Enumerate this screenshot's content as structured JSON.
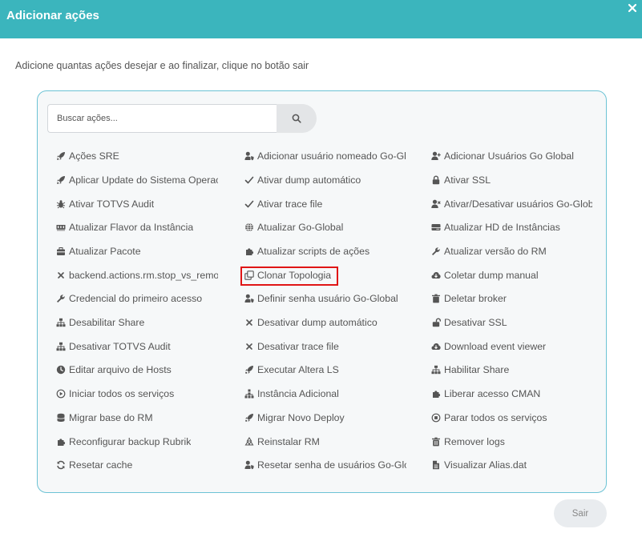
{
  "header": {
    "title": "Adicionar ações"
  },
  "subtitle": "Adicione quantas ações desejar e ao finalizar, clique no botão sair",
  "search": {
    "placeholder": "Buscar ações..."
  },
  "footer": {
    "exit_label": "Sair"
  },
  "actions": {
    "col1": [
      {
        "label": "Ações SRE",
        "icon": "rocket-icon"
      },
      {
        "label": "Aplicar Update do Sistema Operacional",
        "icon": "rocket-icon"
      },
      {
        "label": "Ativar TOTVS Audit",
        "icon": "bug-icon"
      },
      {
        "label": "Atualizar Flavor da Instância",
        "icon": "memory-icon"
      },
      {
        "label": "Atualizar Pacote",
        "icon": "toolbox-icon"
      },
      {
        "label": "backend.actions.rm.stop_vs_remote",
        "icon": "x-icon"
      },
      {
        "label": "Credencial do primeiro acesso",
        "icon": "wrench-icon"
      },
      {
        "label": "Desabilitar Share",
        "icon": "sitemap-icon"
      },
      {
        "label": "Desativar TOTVS Audit",
        "icon": "sitemap-icon"
      },
      {
        "label": "Editar arquivo de Hosts",
        "icon": "clock-icon"
      },
      {
        "label": "Iniciar todos os serviços",
        "icon": "play-circle-icon"
      },
      {
        "label": "Migrar base do RM",
        "icon": "database-icon"
      },
      {
        "label": "Reconfigurar backup Rubrik",
        "icon": "puzzle-icon"
      },
      {
        "label": "Resetar cache",
        "icon": "sync-icon"
      }
    ],
    "col2": [
      {
        "label": "Adicionar usuário nomeado Go-Global",
        "icon": "user-shield-icon"
      },
      {
        "label": "Ativar dump automático",
        "icon": "check-icon"
      },
      {
        "label": "Ativar trace file",
        "icon": "check-icon"
      },
      {
        "label": "Atualizar Go-Global",
        "icon": "globe-icon"
      },
      {
        "label": "Atualizar scripts de ações",
        "icon": "puzzle-icon"
      },
      {
        "label": "Clonar Topologia",
        "icon": "copy-icon"
      },
      {
        "label": "Definir senha usuário Go-Global",
        "icon": "user-shield-icon"
      },
      {
        "label": "Desativar dump automático",
        "icon": "x-icon"
      },
      {
        "label": "Desativar trace file",
        "icon": "x-icon"
      },
      {
        "label": "Executar Altera LS",
        "icon": "rocket-icon"
      },
      {
        "label": "Instância Adicional",
        "icon": "network-icon"
      },
      {
        "label": "Migrar Novo Deploy",
        "icon": "rocket-icon"
      },
      {
        "label": "Reinstalar RM",
        "icon": "recycle-icon"
      },
      {
        "label": "Resetar senha de usuários Go-Global",
        "icon": "user-shield-icon"
      }
    ],
    "col3": [
      {
        "label": "Adicionar Usuários Go Global",
        "icon": "user-plus-icon"
      },
      {
        "label": "Ativar SSL",
        "icon": "lock-icon"
      },
      {
        "label": "Ativar/Desativar usuários Go-Global",
        "icon": "user-times-icon"
      },
      {
        "label": "Atualizar HD de Instâncias",
        "icon": "hdd-icon"
      },
      {
        "label": "Atualizar versão do RM",
        "icon": "wrench-icon"
      },
      {
        "label": "Coletar dump manual",
        "icon": "cloud-download-icon"
      },
      {
        "label": "Deletar broker",
        "icon": "trash-icon"
      },
      {
        "label": "Desativar SSL",
        "icon": "unlock-icon"
      },
      {
        "label": "Download event viewer",
        "icon": "cloud-download-icon"
      },
      {
        "label": "Habilitar Share",
        "icon": "sitemap-icon"
      },
      {
        "label": "Liberar acesso CMAN",
        "icon": "puzzle-icon"
      },
      {
        "label": "Parar todos os serviços",
        "icon": "stop-circle-icon"
      },
      {
        "label": "Remover logs",
        "icon": "trash-alt-icon"
      },
      {
        "label": "Visualizar Alias.dat",
        "icon": "file-icon"
      }
    ]
  }
}
